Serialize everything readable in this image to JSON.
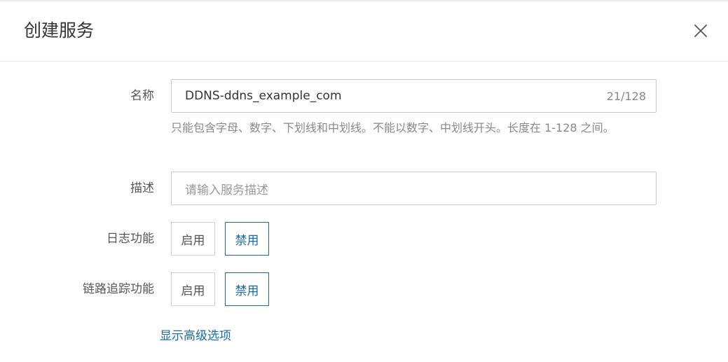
{
  "dialog": {
    "title": "创建服务"
  },
  "form": {
    "name": {
      "label": "名称",
      "value": "DDNS-ddns_example_com",
      "count": "21/128",
      "help": "只能包含字母、数字、下划线和中划线。不能以数字、中划线开头。长度在 1-128 之间。"
    },
    "description": {
      "label": "描述",
      "placeholder": "请输入服务描述"
    },
    "logging": {
      "label": "日志功能",
      "enable_label": "启用",
      "disable_label": "禁用",
      "selected": "禁用"
    },
    "tracing": {
      "label": "链路追踪功能",
      "enable_label": "启用",
      "disable_label": "禁用",
      "selected": "禁用"
    },
    "advanced_link": "显示高级选项"
  },
  "colors": {
    "accent": "#1b6aa5",
    "border": "#d0d0d0",
    "help_text": "#888888"
  },
  "icons": {
    "close": "close-icon"
  }
}
